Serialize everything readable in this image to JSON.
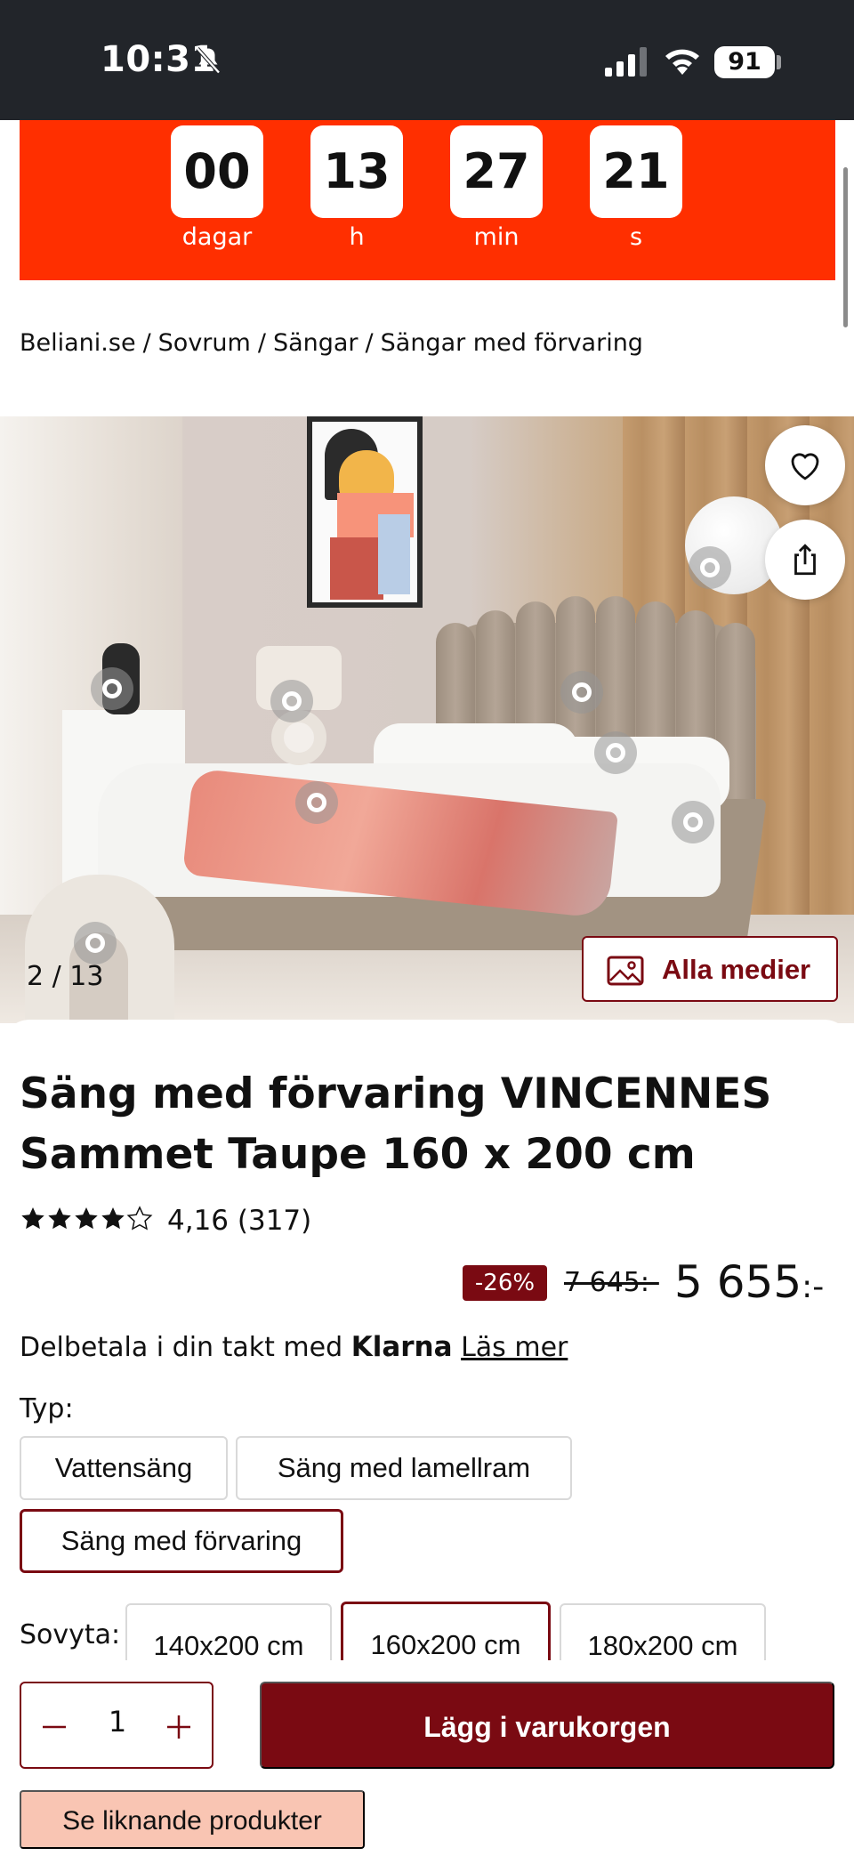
{
  "status_bar": {
    "time": "10:31",
    "battery": "91"
  },
  "countdown": [
    {
      "value": "00",
      "label": "dagar"
    },
    {
      "value": "13",
      "label": "h"
    },
    {
      "value": "27",
      "label": "min"
    },
    {
      "value": "21",
      "label": "s"
    }
  ],
  "breadcrumb": [
    "Beliani.se",
    "Sovrum",
    "Sängar",
    "Sängar med förvaring"
  ],
  "gallery": {
    "counter": "2 / 13",
    "all_media_label": "Alla medier"
  },
  "product": {
    "title": "Säng med förvaring VINCENNES Sammet Taupe 160 x 200 cm",
    "rating_value": 4.16,
    "rating_text": "4,16 (317)",
    "discount": "-26%",
    "old_price": "7 645:-",
    "price_main": "5 655",
    "price_suffix": ":-"
  },
  "klarna": {
    "prefix": "Delbetala i din takt med",
    "brand": "Klarna",
    "link": "Läs mer"
  },
  "type": {
    "label": "Typ:",
    "options": [
      "Vattensäng",
      "Säng med lamellram",
      "Säng med förvaring"
    ],
    "selected": "Säng med förvaring"
  },
  "sleep_area": {
    "label": "Sovyta:",
    "options": [
      "140x200 cm",
      "160x200 cm",
      "180x200 cm"
    ],
    "selected": "160x200 cm"
  },
  "cart": {
    "quantity": "1",
    "add_label": "Lägg i varukorgen",
    "similar_label": "Se liknande produkter"
  },
  "colors": {
    "accent": "#7a0a12",
    "banner": "#ff2f00",
    "similar_bg": "#f9c5b3"
  }
}
